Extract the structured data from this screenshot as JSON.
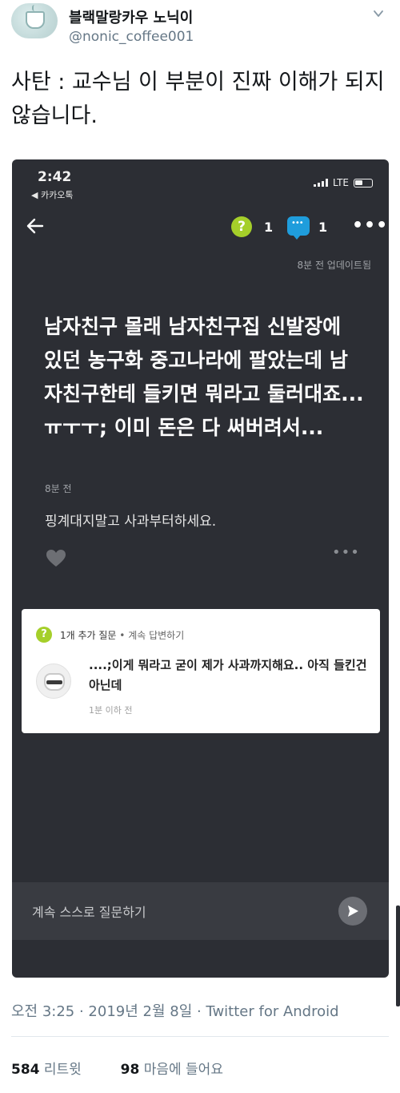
{
  "tweet": {
    "display_name": "블랙말랑카우 노닉이",
    "handle": "@nonic_coffee001",
    "text": "사탄 : 교수님 이 부분이 진짜 이해가 되지않습니다.",
    "meta": "오전 3:25 · 2019년 2월 8일 · Twitter for Android",
    "retweet_count": "584",
    "retweet_label": "리트윗",
    "like_count": "98",
    "like_label": "마음에 들어요"
  },
  "phone": {
    "status": {
      "time": "2:42",
      "back_app": "◀ 카카오톡",
      "network": "LTE"
    },
    "nav": {
      "question_count": "1",
      "answer_count": "1",
      "question_badge": "?"
    },
    "updated": "8분 전 업데이트됨",
    "question": "남자친구 몰래 남자친구집 신발장에 있던 농구화 중고나라에 팔았는데 남자친구한테 들키면 뭐라고 둘러대죠...ㅠㅜㅜ; 이미 돈은 다 써버려서...",
    "question_time": "8분 전",
    "answer": "핑계대지말고 사과부터하세요.",
    "followup": {
      "badge": "?",
      "title": "1개 추가 질문",
      "separator": "•",
      "action": "계속 답변하기",
      "text": "....;이게 뭐라고 굳이 제가 사과까지해요.. 아직 들킨건 아닌데",
      "time": "1분 이하 전"
    },
    "compose_placeholder": "계속 스스로 질문하기"
  }
}
